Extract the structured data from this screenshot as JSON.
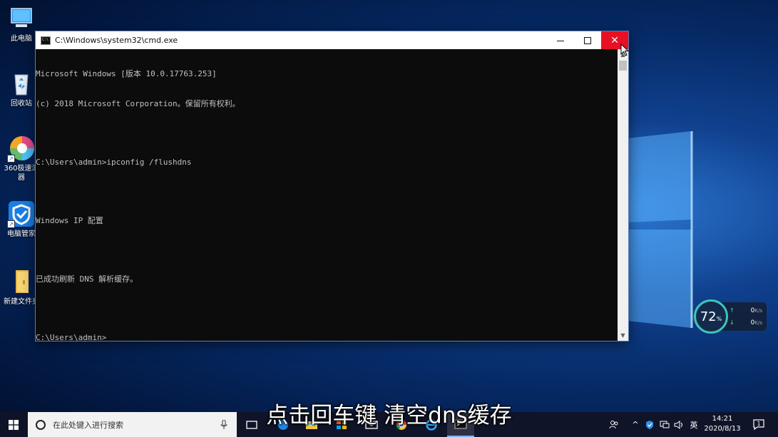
{
  "desktop": {
    "icons": [
      {
        "label": "此电脑",
        "icon": "computer-icon"
      },
      {
        "label": "回收站",
        "icon": "recycle-bin-icon"
      },
      {
        "label": "360极速浏\n器",
        "icon": "browser-360-icon"
      },
      {
        "label": "电脑管家",
        "icon": "pc-manager-icon"
      },
      {
        "label": "新建文件夹",
        "icon": "folder-icon"
      }
    ]
  },
  "cmd_window": {
    "title": "C:\\Windows\\system32\\cmd.exe",
    "lines": [
      "Microsoft Windows [版本 10.0.17763.253]",
      "(c) 2018 Microsoft Corporation。保留所有权利。",
      "",
      "C:\\Users\\admin>ipconfig /flushdns",
      "",
      "Windows IP 配置",
      "",
      "已成功刷新 DNS 解析缓存。",
      "",
      "C:\\Users\\admin>"
    ],
    "close_glyph": "✕"
  },
  "network_widget": {
    "percent": "72",
    "percent_unit": "%",
    "upload": "0",
    "download": "0",
    "unit": "K/s"
  },
  "subtitle": "点击回车键 清空dns缓存",
  "taskbar": {
    "search_placeholder": "在此处键入进行搜索",
    "tray_ime": "英",
    "time": "14:21",
    "date": "2020/8/13",
    "notification_count": "1"
  },
  "colors": {
    "close_red": "#e81123",
    "console_bg": "#0c0c0c",
    "console_text": "#c0c0c0",
    "accent_teal": "#3dc6b8"
  }
}
